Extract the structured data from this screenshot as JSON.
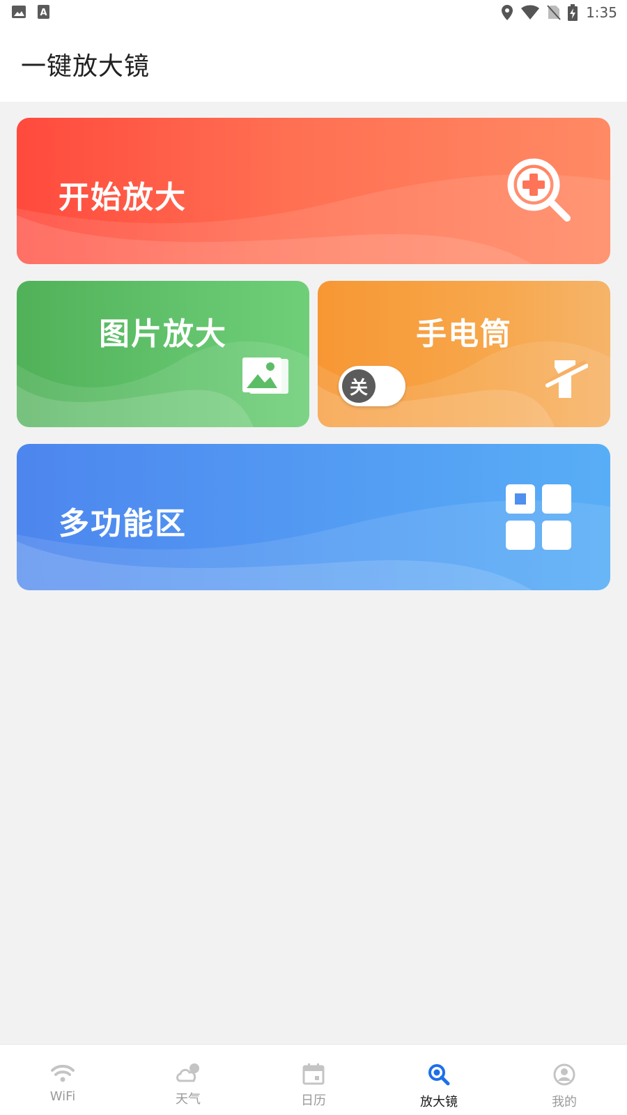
{
  "status_bar": {
    "time": "1:35",
    "left_icons": [
      "image-icon",
      "font-icon"
    ],
    "right_icons": [
      "location-icon",
      "wifi-signal-icon",
      "no-sim-icon",
      "battery-charging-icon"
    ]
  },
  "app_bar": {
    "title": "一键放大镜"
  },
  "cards": {
    "start_zoom": {
      "label": "开始放大",
      "icon": "zoom-in-icon"
    },
    "image_zoom": {
      "label": "图片放大",
      "icon": "photo-icon"
    },
    "flashlight": {
      "label": "手电筒",
      "icon": "flashlight-off-icon",
      "toggle_label": "关",
      "toggle_on": false
    },
    "multi_function": {
      "label": "多功能区",
      "icon": "grid-icon"
    }
  },
  "bottom_nav": {
    "items": [
      {
        "label": "WiFi",
        "icon": "wifi-icon",
        "active": false
      },
      {
        "label": "天气",
        "icon": "weather-cloud-icon",
        "active": false
      },
      {
        "label": "日历",
        "icon": "calendar-icon",
        "active": false
      },
      {
        "label": "放大镜",
        "icon": "magnifier-icon",
        "active": true
      },
      {
        "label": "我的",
        "icon": "profile-icon",
        "active": false
      }
    ]
  },
  "colors": {
    "start_card": "#ff5a45",
    "image_card": "#5cbd66",
    "flashlight_card": "#f7a540",
    "multi_card": "#529af2",
    "nav_active": "#1e6fe8",
    "nav_inactive": "#bdbdbd"
  }
}
